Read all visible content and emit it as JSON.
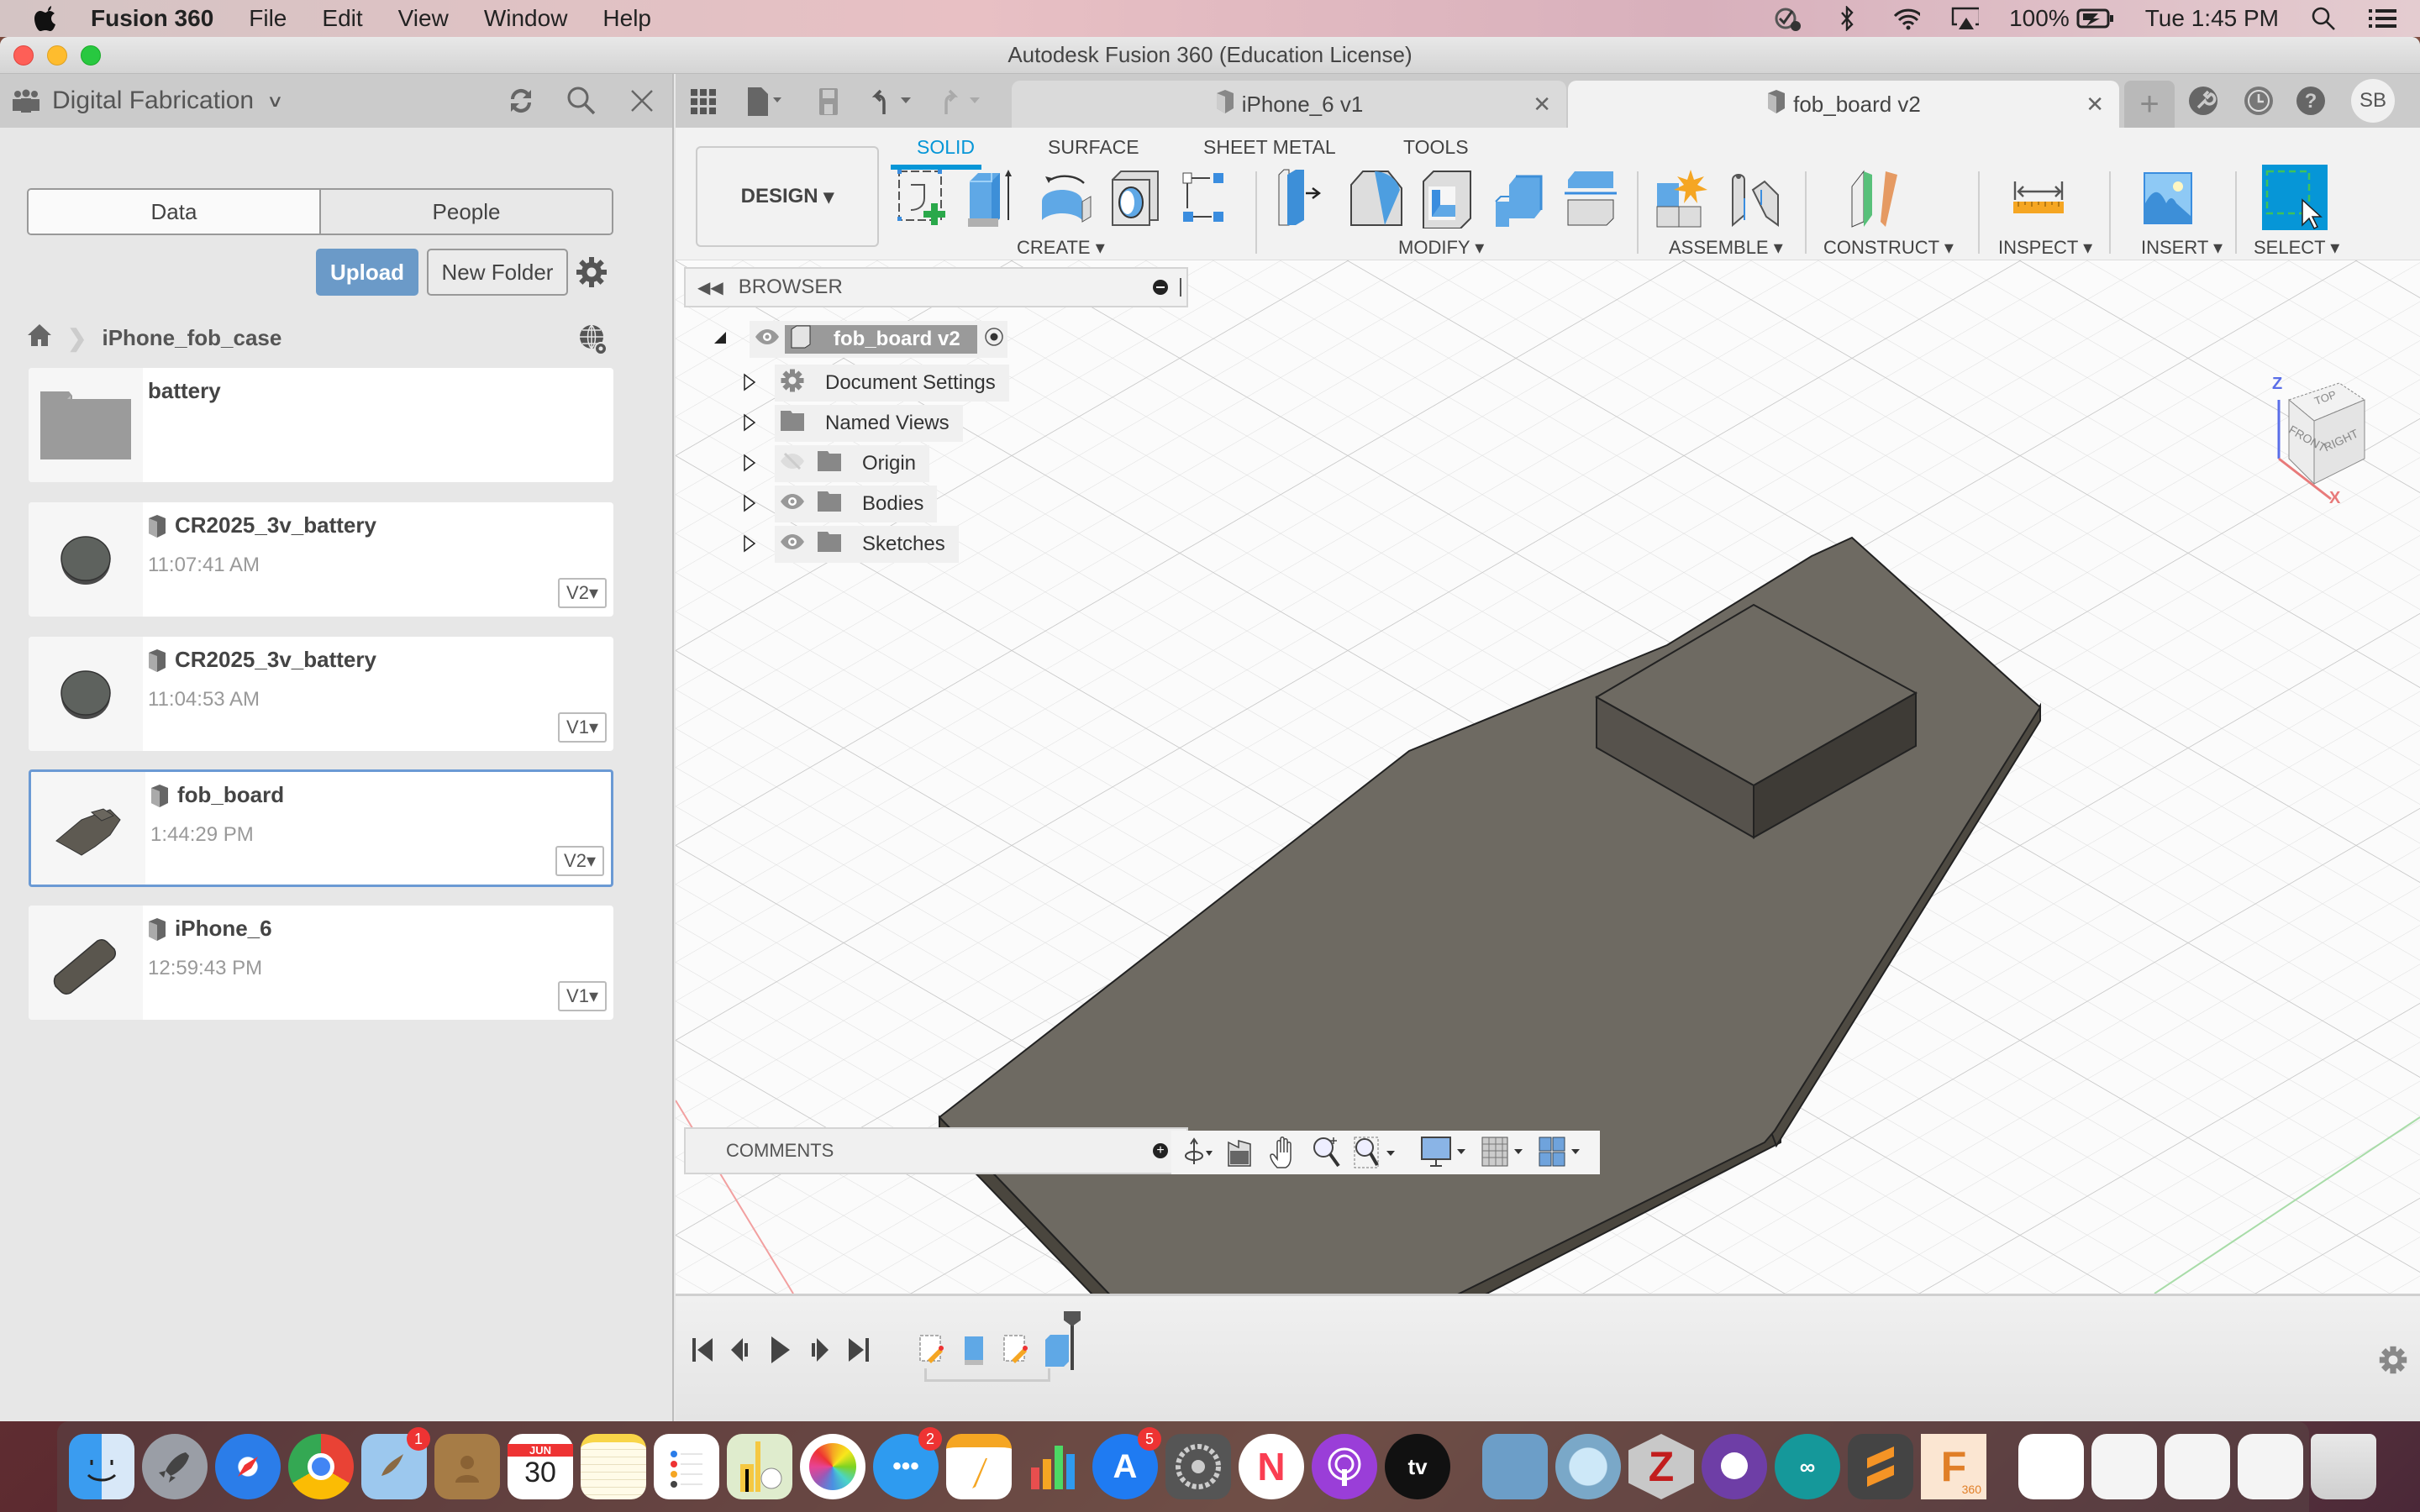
{
  "menubar": {
    "app_name": "Fusion 360",
    "items": [
      "File",
      "Edit",
      "View",
      "Window",
      "Help"
    ],
    "battery": "100%",
    "clock": "Tue 1:45 PM"
  },
  "window": {
    "title": "Autodesk Fusion 360 (Education License)"
  },
  "data_panel": {
    "team": "Digital Fabrication",
    "tabs": [
      "Data",
      "People"
    ],
    "upload_label": "Upload",
    "new_folder_label": "New Folder",
    "breadcrumb": "iPhone_fob_case",
    "items": [
      {
        "type": "folder",
        "name": "battery"
      },
      {
        "type": "design",
        "name": "CR2025_3v_battery",
        "time": "11:07:41 AM",
        "version": "V2"
      },
      {
        "type": "design",
        "name": "CR2025_3v_battery",
        "time": "11:04:53 AM",
        "version": "V1"
      },
      {
        "type": "design",
        "name": "fob_board",
        "time": "1:44:29 PM",
        "version": "V2",
        "selected": true
      },
      {
        "type": "design",
        "name": "iPhone_6",
        "time": "12:59:43 PM",
        "version": "V1"
      }
    ]
  },
  "doc_tabs": [
    {
      "label": "iPhone_6 v1",
      "active": false
    },
    {
      "label": "fob_board v2",
      "active": true
    }
  ],
  "user_initials": "SB",
  "ribbon": {
    "workspace": "DESIGN",
    "tabs": [
      "SOLID",
      "SURFACE",
      "SHEET METAL",
      "TOOLS"
    ],
    "active_tab": "SOLID",
    "groups": [
      "CREATE",
      "MODIFY",
      "ASSEMBLE",
      "CONSTRUCT",
      "INSPECT",
      "INSERT",
      "SELECT"
    ]
  },
  "browser": {
    "title": "BROWSER",
    "root": "fob_board v2",
    "nodes": [
      "Document Settings",
      "Named Views",
      "Origin",
      "Bodies",
      "Sketches"
    ]
  },
  "viewcube": {
    "top": "TOP",
    "front": "FRONT",
    "right": "RIGHT",
    "axis_z": "Z",
    "axis_x": "X"
  },
  "comments_label": "COMMENTS",
  "dock": {
    "badges": {
      "mail": "1",
      "messages": "2",
      "appstore": "5"
    },
    "calendar_month": "JUN",
    "calendar_day": "30",
    "fusion_label": "360"
  },
  "colors": {
    "accent": "#0696d7",
    "upload": "#6b9ac8",
    "model": "#6e6a62"
  }
}
